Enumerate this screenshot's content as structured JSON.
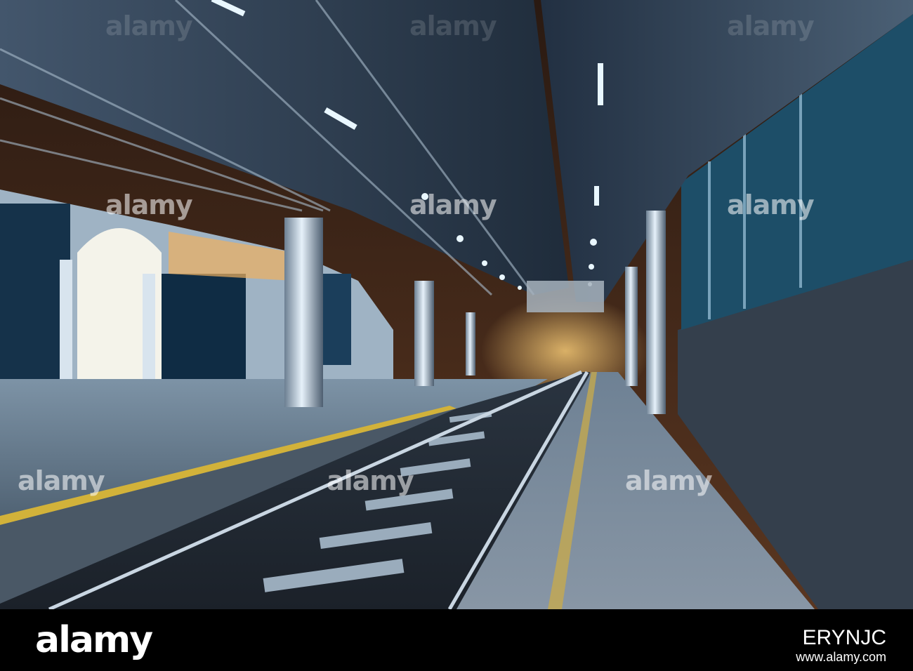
{
  "photo": {
    "subject": "Night railway station platform with canopy and tracks",
    "colors": {
      "sky": "#3a2418",
      "canopy": "#2b3e55",
      "light": "#e9f7ff",
      "platform": "#5f7488",
      "granite": "#3b4654",
      "rail": "#b8c7d6",
      "yellow_line": "#d2b23a",
      "glass": "#1d4e68"
    }
  },
  "watermarks": [
    "alamy",
    "alamy",
    "alamy",
    "alamy",
    "alamy",
    "alamy",
    "alamy",
    "alamy",
    "alamy"
  ],
  "footer": {
    "logo": "alamy",
    "image_id": "ERYNJC",
    "url": "www.alamy.com"
  }
}
